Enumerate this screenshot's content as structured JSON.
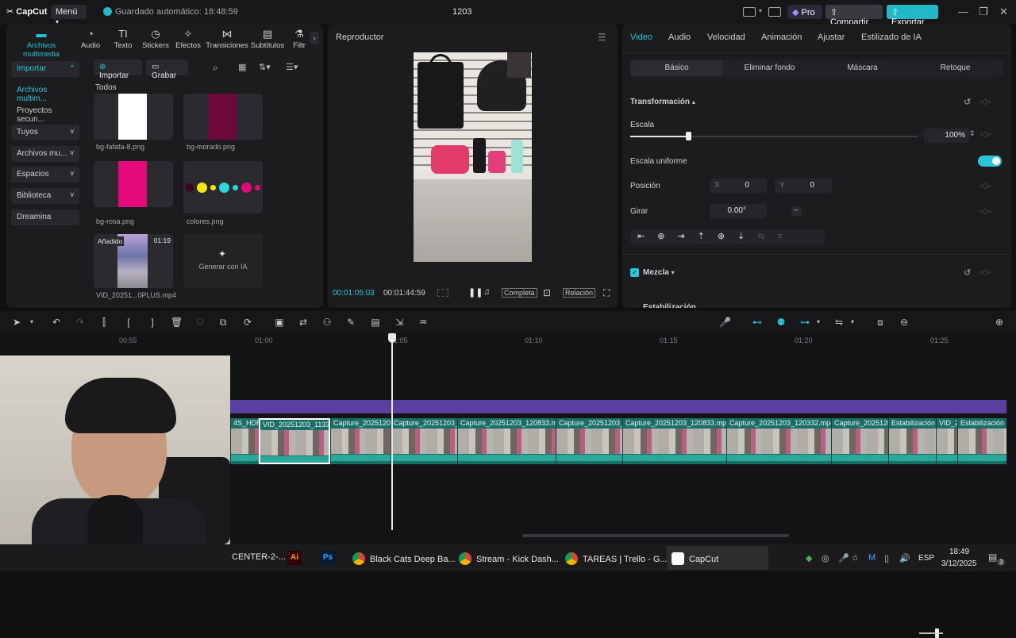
{
  "titlebar": {
    "app_name": "CapCut",
    "menu_label": "Menú",
    "autosave": "Guardado automático: 18:48:59",
    "project_title": "1203",
    "pro_label": "Pro",
    "share_label": "Compartir",
    "export_label": "Exportar"
  },
  "media": {
    "tabs": [
      {
        "label": "Archivos multimedia",
        "icon": "media-icon"
      },
      {
        "label": "Audio",
        "icon": "audio-icon"
      },
      {
        "label": "Texto",
        "icon": "text-icon"
      },
      {
        "label": "Stickers",
        "icon": "sticker-icon"
      },
      {
        "label": "Efectos",
        "icon": "effects-icon"
      },
      {
        "label": "Transiciones",
        "icon": "transitions-icon"
      },
      {
        "label": "Subtítulos",
        "icon": "subtitles-icon"
      },
      {
        "label": "Filtr",
        "icon": "filter-icon"
      }
    ],
    "sidebar": [
      {
        "label": "Importar",
        "chev": "^"
      },
      {
        "label": "Archivos multim...",
        "chev": ""
      },
      {
        "label": "Proyectos secun...",
        "chev": ""
      },
      {
        "label": "Tuyos",
        "chev": "v"
      },
      {
        "label": "Archivos mu...",
        "chev": "v"
      },
      {
        "label": "Espacios",
        "chev": "v"
      },
      {
        "label": "Biblioteca",
        "chev": "v"
      },
      {
        "label": "Dreamina",
        "chev": ""
      }
    ],
    "import_label": "Importar",
    "record_label": "Grabar",
    "section_label": "Todos",
    "items": [
      {
        "name": "bg-fafafa-8.png",
        "color": "#ffffff"
      },
      {
        "name": "bg-morado.png",
        "color": "#6b0a3a"
      },
      {
        "name": "bg-rosa.png",
        "color": "#e4087a"
      },
      {
        "name": "colores.png",
        "color": ""
      },
      {
        "name": "VID_20251...0PLUS.mp4",
        "badge": "Añadido",
        "duration": "01:19"
      }
    ],
    "ai_generate_label": "Generar con IA"
  },
  "player": {
    "title": "Reproductor",
    "current_time": "00:01:05:03",
    "total_time": "00:01:44:59",
    "full_label": "Completa",
    "ratio_label": "Relación"
  },
  "properties": {
    "tabs": [
      "Video",
      "Audio",
      "Velocidad",
      "Animación",
      "Ajustar",
      "Estilizado de IA"
    ],
    "subtabs": [
      "Básico",
      "Eliminar fondo",
      "Máscara",
      "Retoque"
    ],
    "transform_label": "Transformación",
    "scale_label": "Escala",
    "scale_value": "100%",
    "uniform_scale_label": "Escala uniforme",
    "position_label": "Posición",
    "pos_x_label": "X",
    "pos_x": "0",
    "pos_y_label": "Y",
    "pos_y": "0",
    "rotate_label": "Girar",
    "rotate_value": "0.00°",
    "blend_label": "Mezcla",
    "stabilize_label": "Estabilización",
    "scale_fraction": 0.2
  },
  "timeline": {
    "ruler": [
      "00:55",
      "01:00",
      "01:05",
      "01:10",
      "01:15",
      "01:20",
      "01:25"
    ],
    "clips": [
      {
        "name": "4S_HDR"
      },
      {
        "name": "VID_20251203_11334"
      },
      {
        "name": "Capture_20251203"
      },
      {
        "name": "Capture_20251203_12"
      },
      {
        "name": "Capture_20251203_120833.mp"
      },
      {
        "name": "Capture_20251203_1"
      },
      {
        "name": "Capture_20251203_120833.mp4"
      },
      {
        "name": "Capture_20251203_120332.mp4"
      },
      {
        "name": "Capture_2025120"
      },
      {
        "name": "Estabilización"
      },
      {
        "name": "VID_2("
      },
      {
        "name": "Estabilización"
      }
    ]
  },
  "taskbar": {
    "items": [
      {
        "label": "CENTER-2-...",
        "icon": ""
      },
      {
        "label": "",
        "icon": "Ai"
      },
      {
        "label": "",
        "icon": "Ps"
      },
      {
        "label": "Black Cats Deep Ba...",
        "icon": "chrome-icon"
      },
      {
        "label": "Stream - Kick Dash...",
        "icon": "chrome-icon"
      },
      {
        "label": "TAREAS | Trello - G...",
        "icon": "chrome-icon"
      },
      {
        "label": "CapCut",
        "icon": "capcut-icon"
      }
    ],
    "lang": "ESP",
    "time": "18:49",
    "date": "3/12/2025",
    "notif_count": "3"
  }
}
